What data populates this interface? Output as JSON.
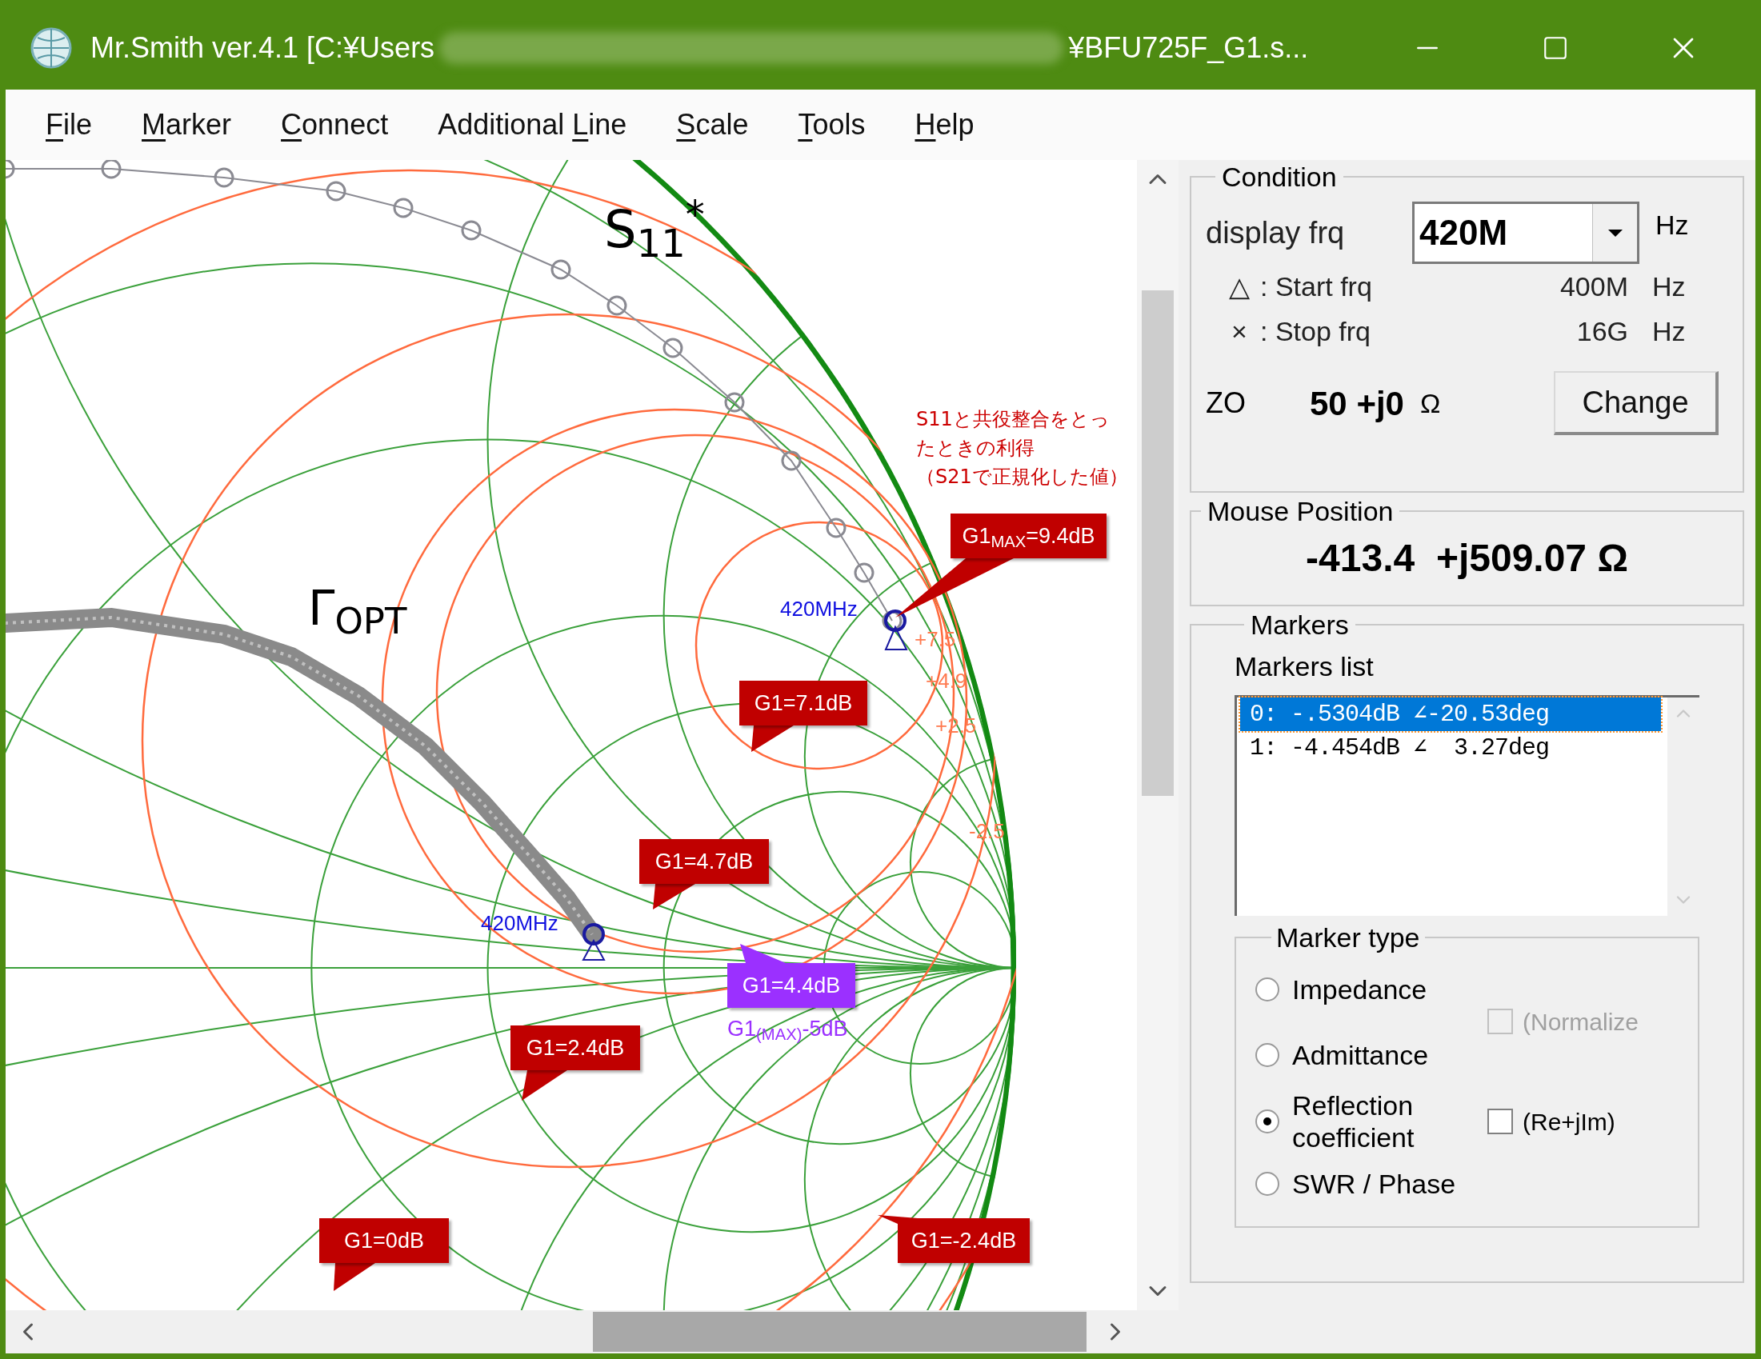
{
  "window": {
    "title_start": "Mr.Smith ver.4.1 [C:¥Users",
    "title_end": "¥BFU725F_G1.s..."
  },
  "menu": [
    {
      "key": "F",
      "post": "ile"
    },
    {
      "key": "M",
      "post": "arker"
    },
    {
      "key": "C",
      "post": "onnect"
    },
    {
      "pre": "Additional ",
      "key": "L",
      "post": "ine"
    },
    {
      "key": "S",
      "post": "cale"
    },
    {
      "key": "T",
      "post": "ools"
    },
    {
      "key": "H",
      "post": "elp"
    }
  ],
  "chart": {
    "trace_labels": [
      "S$_{11}$$^{*}$",
      "Γ$_{OPT}$"
    ],
    "note_lines": [
      "S11と共役整合をとっ",
      "たときの利得",
      "（S21で正規化した値）"
    ],
    "frequency_labels": [
      "420MHz",
      "420MHz"
    ],
    "callouts": [
      {
        "text": "G1$_{MAX}$=9.4dB",
        "kind": "normal"
      },
      {
        "text": "G1=7.1dB",
        "kind": "normal"
      },
      {
        "text": "G1=4.7dB",
        "kind": "normal"
      },
      {
        "text": "G1=4.4dB",
        "kind": "highlight"
      },
      {
        "text": "G1=2.4dB",
        "kind": "normal"
      },
      {
        "text": "G1=0dB",
        "kind": "normal"
      },
      {
        "text": "G1=-2.4dB",
        "kind": "normal"
      }
    ],
    "callout_caption": "G1$_{(MAX)}$-5dB",
    "scale_labels": [
      "+7.5",
      "+4.9",
      "+2.5",
      "-2.5"
    ]
  },
  "condition": {
    "title": "Condition",
    "display_label": "display frq",
    "display_value": "420M",
    "display_unit": "Hz",
    "rows": [
      {
        "symbol": "△",
        "label": ": Start frq",
        "value": "400M",
        "unit": "Hz"
      },
      {
        "symbol": "×",
        "label": ": Stop frq",
        "value": "16G",
        "unit": "Hz"
      }
    ],
    "z0_label": "ZO",
    "z0_value": "50 +j0",
    "z0_unit": "Ω",
    "change_button": "Change"
  },
  "mouse_position": {
    "title": "Mouse Position",
    "value": "-413.4  +j509.07 Ω"
  },
  "markers": {
    "title": "Markers",
    "list_label": "Markers list",
    "items": [
      {
        "text": "0: -.5304dB ∠-20.53deg",
        "selected": true
      },
      {
        "text": "1: -4.454dB ∠  3.27deg",
        "selected": false
      }
    ],
    "type_title": "Marker type",
    "types": [
      {
        "label": "Impedance",
        "selected": false
      },
      {
        "label": "Admittance",
        "selected": false
      },
      {
        "label": "Reflection\ncoefficient",
        "selected": true
      },
      {
        "label": "SWR / Phase",
        "selected": false
      }
    ],
    "options": [
      {
        "label": "(Normalize",
        "checked": false,
        "disabled": true
      },
      {
        "label": "(Re+jIm)",
        "checked": false,
        "disabled": false
      }
    ]
  }
}
